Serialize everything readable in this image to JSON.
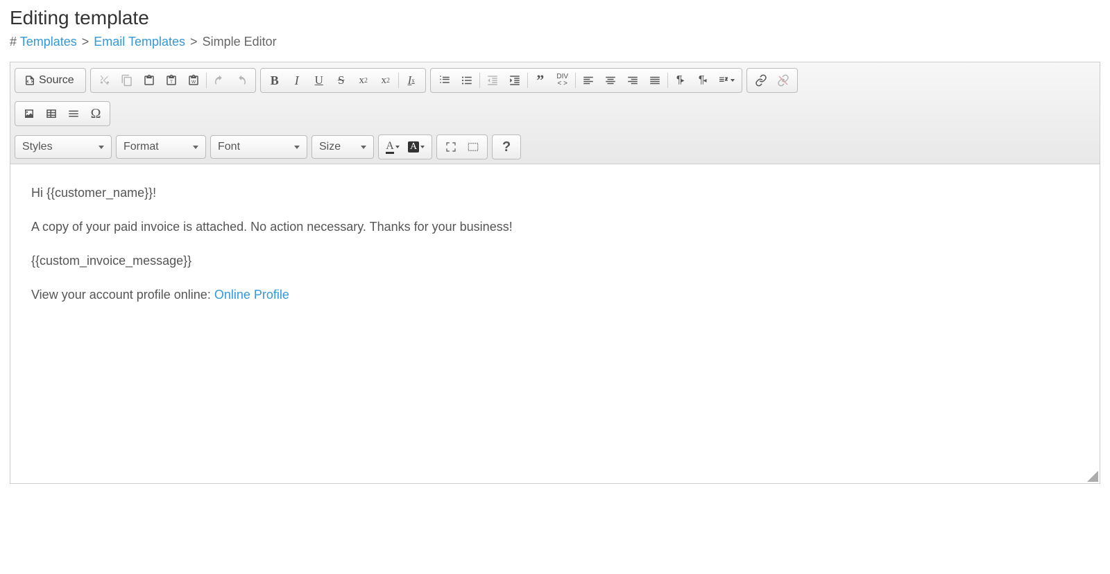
{
  "page": {
    "title": "Editing template"
  },
  "breadcrumb": {
    "hash": "#",
    "items": [
      {
        "label": "Templates",
        "link": true
      },
      {
        "label": "Email Templates",
        "link": true
      },
      {
        "label": "Simple Editor",
        "link": false
      }
    ],
    "sep": ">"
  },
  "toolbar": {
    "source_label": "Source",
    "dropdowns": {
      "styles": "Styles",
      "format": "Format",
      "font": "Font",
      "size": "Size"
    }
  },
  "content": {
    "p1": "Hi {{customer_name}}!",
    "p2": "A copy of your paid invoice is attached. No action necessary. Thanks for your business!",
    "p3": "{{custom_invoice_message}}",
    "p4_prefix": "View your account profile online: ",
    "p4_link": "Online Profile"
  }
}
